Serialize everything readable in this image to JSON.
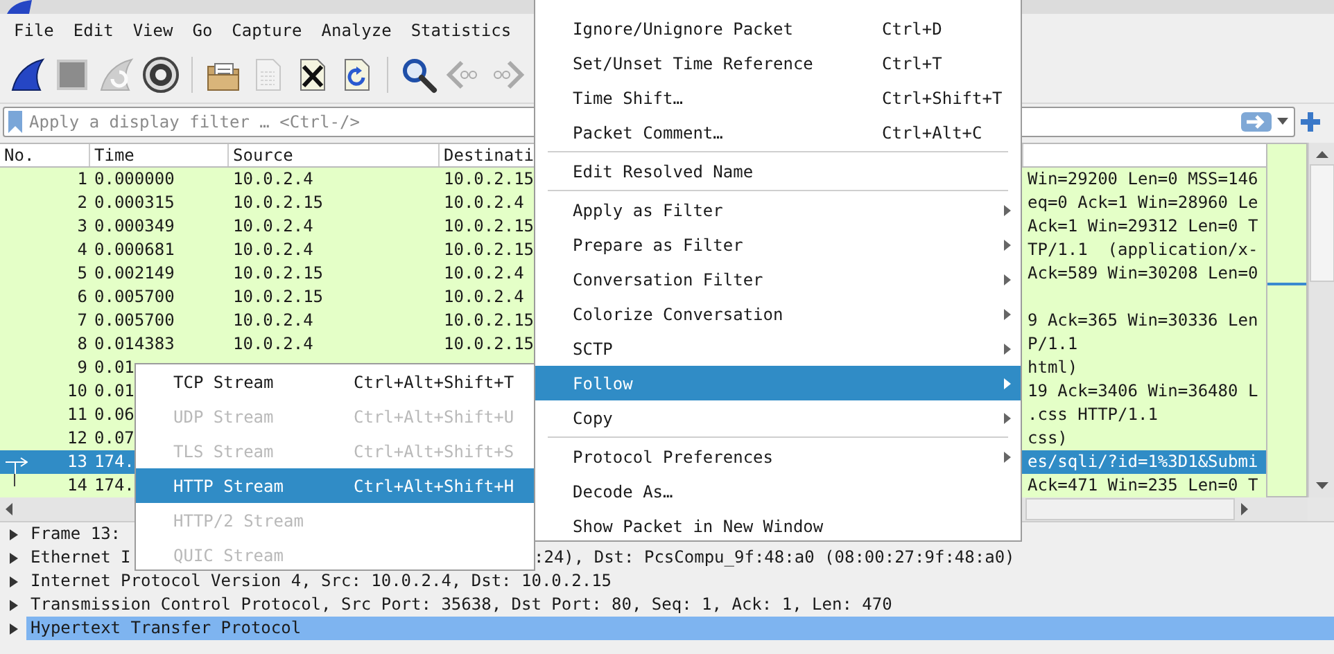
{
  "menubar": {
    "items": [
      "File",
      "Edit",
      "View",
      "Go",
      "Capture",
      "Analyze",
      "Statistics"
    ]
  },
  "toolbar": {
    "buttons": [
      {
        "kind": "start",
        "disabled": false
      },
      {
        "kind": "stop",
        "disabled": false
      },
      {
        "kind": "restart",
        "disabled": true
      },
      {
        "kind": "options",
        "disabled": false
      },
      {
        "kind": "separator"
      },
      {
        "kind": "open",
        "disabled": false
      },
      {
        "kind": "file",
        "disabled": true
      },
      {
        "kind": "close",
        "disabled": false
      },
      {
        "kind": "reload",
        "disabled": false
      },
      {
        "kind": "separator"
      },
      {
        "kind": "find",
        "disabled": false
      },
      {
        "kind": "back",
        "disabled": false
      },
      {
        "kind": "forward",
        "disabled": false
      }
    ]
  },
  "filter": {
    "placeholder": "Apply a display filter … <Ctrl-/>"
  },
  "packet_list": {
    "columns": [
      "No.",
      "Time",
      "Source",
      "Destinati"
    ],
    "rows": [
      {
        "no": "1",
        "time": "0.000000",
        "source": "10.0.2.4",
        "destination": "10.0.2.15",
        "info": "Win=29200 Len=0 MSS=146",
        "selected": false
      },
      {
        "no": "2",
        "time": "0.000315",
        "source": "10.0.2.15",
        "destination": "10.0.2.4",
        "info": "eq=0 Ack=1 Win=28960 Le",
        "selected": false
      },
      {
        "no": "3",
        "time": "0.000349",
        "source": "10.0.2.4",
        "destination": "10.0.2.15",
        "info": "Ack=1 Win=29312 Len=0 T",
        "selected": false
      },
      {
        "no": "4",
        "time": "0.000681",
        "source": "10.0.2.4",
        "destination": "10.0.2.15",
        "info": "TP/1.1  (application/x-",
        "selected": false
      },
      {
        "no": "5",
        "time": "0.002149",
        "source": "10.0.2.15",
        "destination": "10.0.2.4",
        "info": "Ack=589 Win=30208 Len=0",
        "selected": false
      },
      {
        "no": "6",
        "time": "0.005700",
        "source": "10.0.2.15",
        "destination": "10.0.2.4",
        "selected": false
      },
      {
        "no": "7",
        "time": "0.005700",
        "source": "10.0.2.4",
        "destination": "10.0.2.15",
        "info": "9 Ack=365 Win=30336 Len",
        "selected": false
      },
      {
        "no": "8",
        "time": "0.014383",
        "source": "10.0.2.4",
        "destination": "10.0.2.15",
        "info": "P/1.1",
        "selected": false
      },
      {
        "no": "9",
        "time": "0.01",
        "info": "html)",
        "selected": false
      },
      {
        "no": "10",
        "time": "0.01",
        "info": "19 Ack=3406 Win=36480 L",
        "selected": false
      },
      {
        "no": "11",
        "time": "0.06",
        "info": ".css HTTP/1.1",
        "selected": false
      },
      {
        "no": "12",
        "time": "0.07",
        "info": "css)",
        "selected": false
      },
      {
        "no": "13",
        "time": "174.",
        "info": "es/sqli/?id=1%3D1&Submi",
        "selected": true,
        "kind": "request"
      },
      {
        "no": "14",
        "time": "174.",
        "info": "Ack=471 Win=235 Len=0 T",
        "selected": false,
        "kind": "line"
      }
    ]
  },
  "details": {
    "rows": [
      {
        "segments": [
          "Frame 13:"
        ],
        "expanded": false,
        "selected": false
      },
      {
        "segments": [
          "Ethernet I",
          ":24), Dst: PcsCompu_9f:48:a0 (08:00:27:9f:48:a0)"
        ],
        "expanded": false,
        "selected": false
      },
      {
        "segments": [
          "Internet Protocol Version 4, Src: 10.0.2.4, Dst: 10.0.2.15"
        ],
        "expanded": false,
        "selected": false
      },
      {
        "segments": [
          "Transmission Control Protocol, Src Port: 35638, Dst Port: 80, Seq: 1, Ack: 1, Len: 470"
        ],
        "expanded": false,
        "selected": false
      },
      {
        "segments": [
          "Hypertext Transfer Protocol"
        ],
        "expanded": false,
        "selected": true
      }
    ]
  },
  "context_menu": {
    "items": [
      {
        "kind": "item",
        "label": "Ignore/Unignore Packet",
        "shortcut": "Ctrl+D",
        "submenu": false,
        "selected": false
      },
      {
        "kind": "item",
        "label": "Set/Unset Time Reference",
        "shortcut": "Ctrl+T",
        "submenu": false,
        "selected": false
      },
      {
        "kind": "item",
        "label": "Time Shift…",
        "shortcut": "Ctrl+Shift+T",
        "submenu": false,
        "selected": false
      },
      {
        "kind": "item",
        "label": "Packet Comment…",
        "shortcut": "Ctrl+Alt+C",
        "submenu": false,
        "selected": false
      },
      {
        "kind": "separator"
      },
      {
        "kind": "item",
        "label": "Edit Resolved Name",
        "submenu": false,
        "selected": false
      },
      {
        "kind": "separator"
      },
      {
        "kind": "item",
        "label": "Apply as Filter",
        "submenu": true,
        "selected": false
      },
      {
        "kind": "item",
        "label": "Prepare as Filter",
        "submenu": true,
        "selected": false
      },
      {
        "kind": "item",
        "label": "Conversation Filter",
        "submenu": true,
        "selected": false
      },
      {
        "kind": "item",
        "label": "Colorize Conversation",
        "submenu": true,
        "selected": false
      },
      {
        "kind": "item",
        "label": "SCTP",
        "submenu": true,
        "selected": false
      },
      {
        "kind": "item",
        "label": "Follow",
        "submenu": true,
        "selected": true
      },
      {
        "kind": "item",
        "label": "Copy",
        "submenu": true,
        "selected": false
      },
      {
        "kind": "separator"
      },
      {
        "kind": "item",
        "label": "Protocol Preferences",
        "submenu": true,
        "selected": false
      },
      {
        "kind": "item",
        "label": "Decode As…",
        "submenu": false,
        "selected": false
      },
      {
        "kind": "item",
        "label": "Show Packet in New Window",
        "submenu": false,
        "selected": false
      }
    ]
  },
  "follow_submenu": {
    "items": [
      {
        "label": "TCP Stream",
        "shortcut": "Ctrl+Alt+Shift+T",
        "disabled": false,
        "selected": false
      },
      {
        "label": "UDP Stream",
        "shortcut": "Ctrl+Alt+Shift+U",
        "disabled": true,
        "selected": false
      },
      {
        "label": "TLS Stream",
        "shortcut": "Ctrl+Alt+Shift+S",
        "disabled": true,
        "selected": false
      },
      {
        "label": "HTTP Stream",
        "shortcut": "Ctrl+Alt+Shift+H",
        "disabled": false,
        "selected": true
      },
      {
        "label": "HTTP/2 Stream",
        "disabled": true,
        "selected": false
      },
      {
        "label": "QUIC Stream",
        "disabled": true,
        "selected": false
      }
    ]
  }
}
